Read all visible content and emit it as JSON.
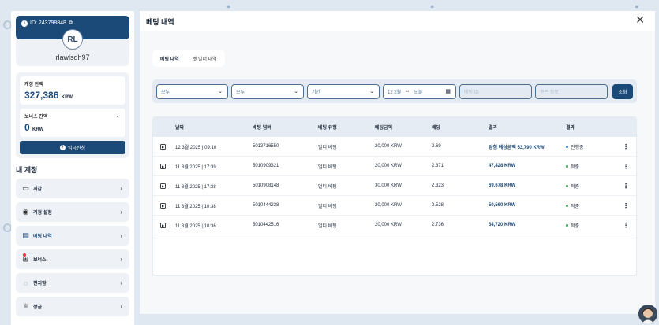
{
  "sidebar": {
    "user_id": "ID: 243798848",
    "avatar_initials": "RL",
    "username": "rlawlsdh97",
    "account_balance_label": "계정 잔액",
    "account_balance_value": "327,386",
    "account_balance_unit": "KRW",
    "bonus_balance_label": "보너스 잔액",
    "bonus_balance_value": "0",
    "bonus_balance_unit": "KRW",
    "deposit_button": "입금신청",
    "my_account_title": "내 계정",
    "menu": [
      {
        "label": "지갑",
        "icon": "wallet-icon"
      },
      {
        "label": "계정 설정",
        "icon": "user-settings-icon"
      },
      {
        "label": "베팅 내역",
        "icon": "bet-history-icon"
      },
      {
        "label": "보너스",
        "icon": "gift-icon"
      },
      {
        "label": "편지함",
        "icon": "message-icon"
      },
      {
        "label": "상금",
        "icon": "prize-icon"
      }
    ],
    "active_menu": "베팅 내역"
  },
  "main": {
    "title": "베팅 내역",
    "tabs": [
      {
        "label": "베팅 내역",
        "active": true
      },
      {
        "label": "벳 빌더 내역",
        "active": false
      }
    ],
    "filters": {
      "select1": "모두",
      "select2": "모두",
      "period": "기간",
      "date_from": "12 2월",
      "date_arrow": "↔",
      "date_to": "오늘",
      "bet_id_placeholder": "베팅 ID",
      "coupon_placeholder": "쿠폰 정보",
      "search_button": "조회"
    },
    "table": {
      "headers": [
        "날짜",
        "베팅 넘버",
        "베팅 유형",
        "베팅금액",
        "배당",
        "결과",
        "결과"
      ],
      "rows": [
        {
          "date": "12 3월 2025 | 09:10",
          "number": "5013716550",
          "type": "멀티 베팅",
          "amount": "20,000 KRW",
          "odds": "2.69",
          "result": "당첨 예상금액 53,790 KRW",
          "status": "진행중",
          "status_color": "#2f80d1"
        },
        {
          "date": "11 3월 2025 | 17:39",
          "number": "5010909321",
          "type": "멀티 베팅",
          "amount": "20,000 KRW",
          "odds": "2.371",
          "result": "47,428 KRW",
          "status": "적중",
          "status_color": "#2fa84f"
        },
        {
          "date": "11 3월 2025 | 17:38",
          "number": "5010908148",
          "type": "멀티 베팅",
          "amount": "30,000 KRW",
          "odds": "2.323",
          "result": "69,678 KRW",
          "status": "적중",
          "status_color": "#2fa84f"
        },
        {
          "date": "11 3월 2025 | 10:38",
          "number": "5010444238",
          "type": "멀티 베팅",
          "amount": "20,000 KRW",
          "odds": "2.528",
          "result": "50,560 KRW",
          "status": "적중",
          "status_color": "#2fa84f"
        },
        {
          "date": "11 3월 2025 | 10:36",
          "number": "5010442516",
          "type": "멀티 베팅",
          "amount": "20,000 KRW",
          "odds": "2.736",
          "result": "54,720 KRW",
          "status": "적중",
          "status_color": "#2fa84f"
        }
      ]
    }
  },
  "colors": {
    "primary": "#1c4a78",
    "win": "#2fa84f",
    "pending": "#2f80d1"
  }
}
